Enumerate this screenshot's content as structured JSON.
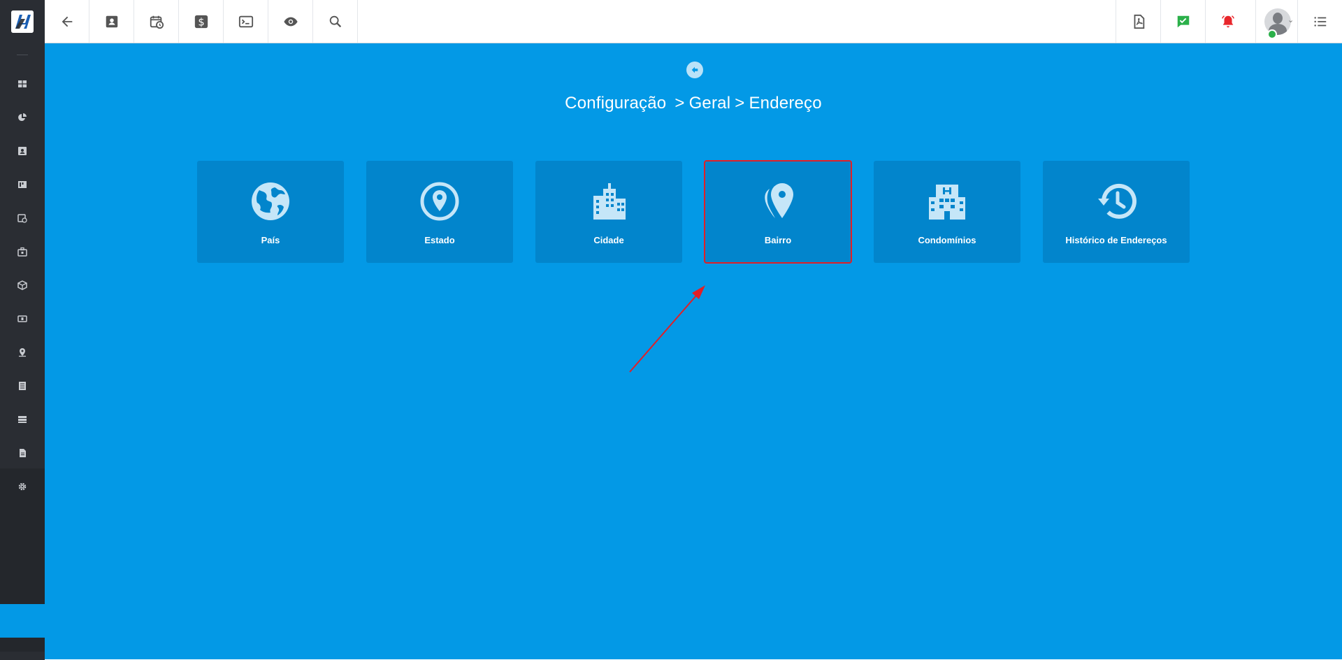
{
  "topbar": {
    "logo_icon": "app-logo",
    "buttons": [
      {
        "name": "back-arrow-icon"
      },
      {
        "name": "contact-card-icon"
      },
      {
        "name": "calendar-clock-icon"
      },
      {
        "name": "dollar-icon"
      },
      {
        "name": "terminal-icon"
      },
      {
        "name": "eye-icon"
      },
      {
        "name": "search-icon"
      }
    ],
    "right_buttons": [
      {
        "name": "pdf-icon"
      },
      {
        "name": "chat-check-icon",
        "color": "#2bb04a"
      },
      {
        "name": "bell-alert-icon",
        "color": "#e8262b"
      },
      {
        "name": "list-menu-icon"
      }
    ]
  },
  "sidebar": {
    "items": [
      "grid-icon",
      "pie-chart-icon",
      "contact-card-icon",
      "kanban-icon",
      "calendar-clock-icon",
      "briefcase-icon",
      "cube-icon",
      "money-icon",
      "map-pin-icon",
      "document-list-icon",
      "server-icon",
      "file-icon",
      "gear-icon"
    ]
  },
  "main": {
    "background": "#0399e6",
    "breadcrumb": {
      "part1": "Configuração",
      "sep": ">",
      "part2": "Geral",
      "part3": "Endereço"
    },
    "cards": [
      {
        "label": "País",
        "icon": "globe-icon"
      },
      {
        "label": "Estado",
        "icon": "location-circle-icon"
      },
      {
        "label": "Cidade",
        "icon": "city-icon"
      },
      {
        "label": "Bairro",
        "icon": "map-pin-icon",
        "highlighted": true
      },
      {
        "label": "Condomínios",
        "icon": "hospital-building-icon"
      },
      {
        "label": "Histórico de Endereços",
        "icon": "history-icon"
      }
    ],
    "annotation_color": "#e21f26"
  }
}
